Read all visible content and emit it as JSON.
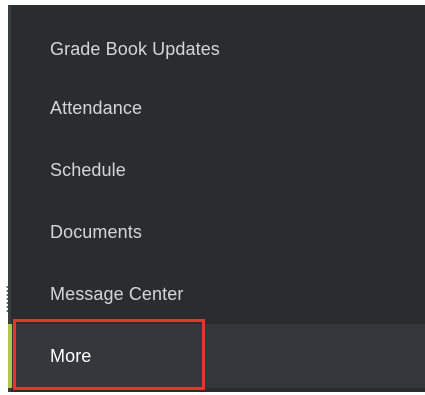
{
  "nav": {
    "items": [
      {
        "label": "Grade Book Updates"
      },
      {
        "label": "Attendance"
      },
      {
        "label": "Schedule"
      },
      {
        "label": "Documents"
      },
      {
        "label": "Message Center"
      },
      {
        "label": "More",
        "active": true
      }
    ]
  },
  "colors": {
    "menu_bg": "#2a2c2f",
    "active_bg": "#34373b",
    "active_indicator": "#b6c44a",
    "highlight_outline": "#e3372b",
    "text": "#d3d6da"
  }
}
